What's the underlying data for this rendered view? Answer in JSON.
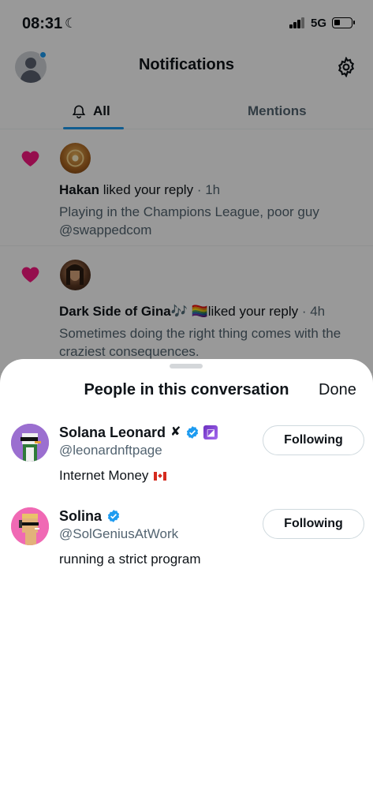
{
  "status_bar": {
    "time": "08:31",
    "moon_glyph": "☾",
    "network": "5G"
  },
  "header": {
    "title": "Notifications",
    "avatar_icon": "profile-avatar",
    "settings_icon": "gear-icon"
  },
  "tabs": [
    {
      "label": "All",
      "icon": "bell-icon",
      "active": true
    },
    {
      "label": "Mentions",
      "active": false
    }
  ],
  "notifications": [
    {
      "icon": "heart-icon",
      "name": "Hakan",
      "action": " liked your reply",
      "time": " · 1h",
      "text": "Playing in the Champions League, poor guy @swappedcom"
    },
    {
      "icon": "heart-icon",
      "name": "Dark Side of Gina🎶 🏳️‍🌈",
      "action": "liked your reply",
      "time": " · 4h",
      "text": "Sometimes doing the right thing comes with the craziest consequences."
    }
  ],
  "sheet": {
    "title": "People in this conversation",
    "done_label": "Done",
    "people": [
      {
        "name": "Solana Leonard",
        "name_suffix": "✘",
        "verified": true,
        "badge_glyph": "◪",
        "handle": "@leonardnftpage",
        "bio": "Internet Money",
        "bio_flag": "canada-flag",
        "button_label": "Following"
      },
      {
        "name": "Solina",
        "verified": true,
        "handle": "@SolGeniusAtWork",
        "bio": "running a strict program",
        "button_label": "Following"
      }
    ]
  },
  "colors": {
    "accent": "#1d9bf0",
    "heart": "#f91880",
    "secondary_text": "#536471",
    "overlay": "rgba(0,0,0,0.4)"
  }
}
